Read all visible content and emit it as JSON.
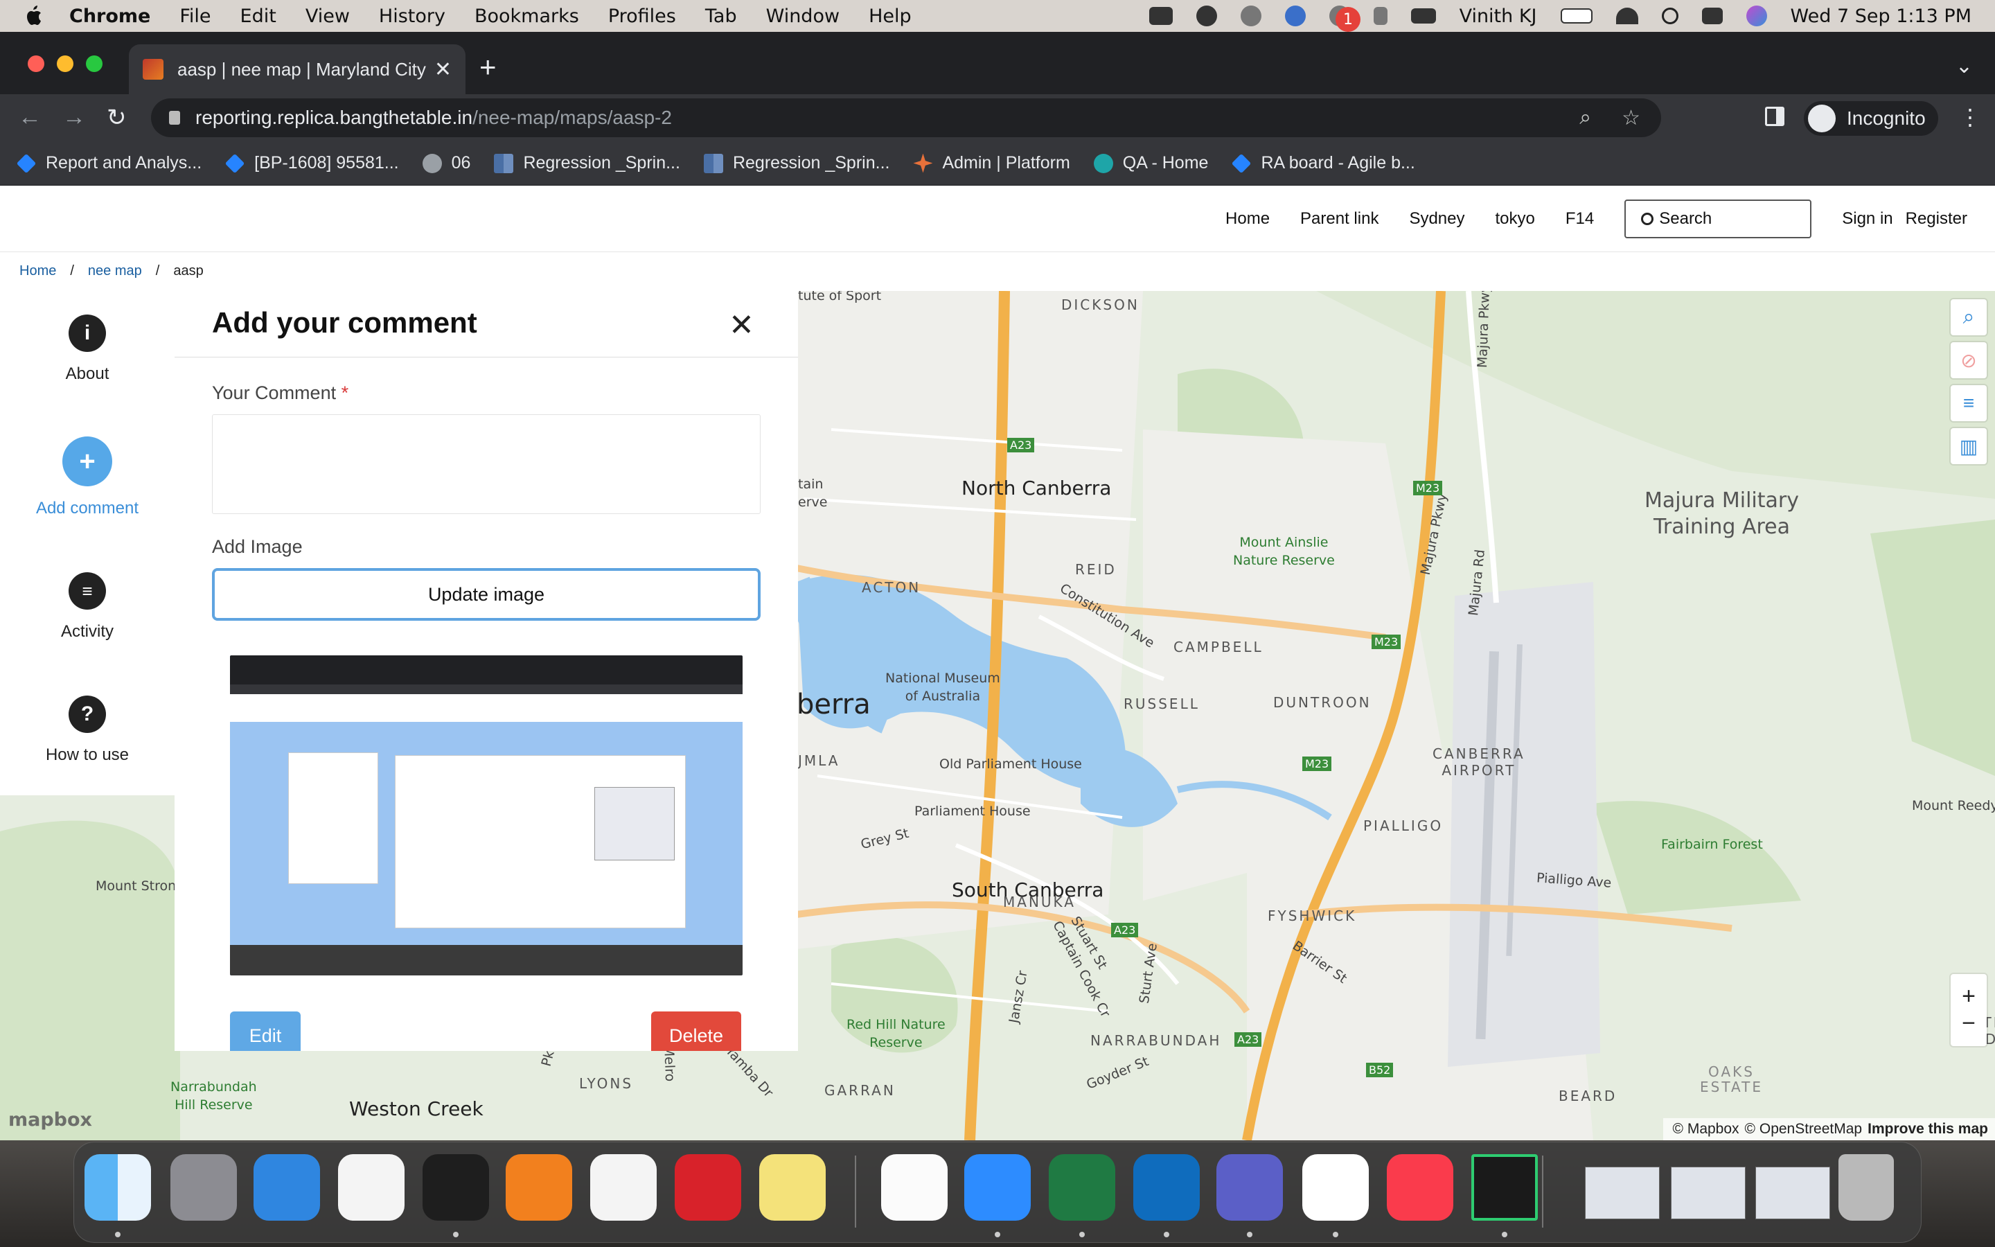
{
  "menubar": {
    "app": "Chrome",
    "items": [
      "File",
      "Edit",
      "View",
      "History",
      "Bookmarks",
      "Profiles",
      "Tab",
      "Window",
      "Help"
    ],
    "user": "Vinith KJ",
    "datetime": "Wed 7 Sep  1:13 PM"
  },
  "browser": {
    "tab_title": "aasp | nee map | Maryland City",
    "url_host": "reporting.replica.bangthetable.in",
    "url_path": "/nee-map/maps/aasp-2",
    "profile": "Incognito",
    "bookmarks": [
      {
        "label": "Report and Analys...",
        "icon": "jira-icon"
      },
      {
        "label": "[BP-1608] 95581...",
        "icon": "jira-icon"
      },
      {
        "label": "06",
        "icon": "globe-icon"
      },
      {
        "label": "Regression _Sprin...",
        "icon": "grid-icon"
      },
      {
        "label": "Regression _Sprin...",
        "icon": "grid-icon"
      },
      {
        "label": "Admin | Platform",
        "icon": "admin-icon"
      },
      {
        "label": "QA - Home",
        "icon": "qa-icon"
      },
      {
        "label": "RA board - Agile b...",
        "icon": "jira-icon"
      }
    ]
  },
  "site": {
    "nav": [
      "Home",
      "Parent link",
      "Sydney",
      "tokyo",
      "F14"
    ],
    "search_placeholder": "Search",
    "sign_in": "Sign in",
    "register": "Register"
  },
  "breadcrumb": {
    "items": [
      "Home",
      "nee map",
      "aasp"
    ],
    "sep": "/"
  },
  "rail": {
    "about": "About",
    "add_comment": "Add comment",
    "activity": "Activity",
    "how_to_use": "How to use"
  },
  "panel": {
    "title": "Add your comment",
    "comment_label": "Your Comment",
    "required_mark": "*",
    "image_label": "Add Image",
    "update_image": "Update image",
    "edit": "Edit",
    "delete": "Delete"
  },
  "map": {
    "labels": {
      "north_canberra": "North Canberra",
      "south_canberra": "South Canberra",
      "majura": "Majura Military\nTraining Area",
      "dickson": "DICKSON",
      "reid": "REID",
      "acton": "ACTON",
      "campbell": "CAMPBELL",
      "russell": "RUSSELL",
      "duntroon": "DUNTROON",
      "airport": "CANBERRA\nAIRPORT",
      "pialligo": "PIALLIGO",
      "fyshwick": "FYSHWICK",
      "manuka": "MANUKA",
      "narrabundah": "NARRABUNDAH",
      "garran": "GARRAN",
      "lyons": "LYONS",
      "beard": "BEARD",
      "museum": "National Museum\nof Australia",
      "old_parliament": "Old Parliament House",
      "parliament": "Parliament House",
      "ainslie": "Mount Ainslie\nNature Reserve",
      "fairbairn": "Fairbairn Forest",
      "red_hill": "Red Hill Nature\nReserve",
      "narrabundah_hill": "Narrabundah\nHill Reserve",
      "mount_stron": "Mount Stron",
      "mount_reedy": "Mount Reedy",
      "weston_creek": "Weston Creek",
      "sport": "tute of Sport",
      "berra": "berra",
      "tain": "tain\nerve",
      "umla": "JMLA",
      "th_ridge": "TH\nRIDGE",
      "oaks": "OAKS\nESTATE",
      "constitution": "Constitution Ave",
      "pialligo_ave": "Pialligo Ave",
      "barrier": "Barrier St",
      "grey": "Grey St",
      "stuart": "Stuart St",
      "captain_cook": "Captain Cook Cr",
      "jansz": "Jansz Cr",
      "sturt": "Sturt Ave",
      "goyder": "Goyder St",
      "yamba": "Yamba Dr",
      "majura_pkwy": "Majura Pkwy",
      "majura_rd": "Majura Rd",
      "a23": "A23",
      "m23": "M23",
      "b52": "B52",
      "pkwy": "Pkwy",
      "melrose": "Melro"
    },
    "attribution_mapbox": "© Mapbox",
    "attribution_osm": "© OpenStreetMap",
    "attribution_improve": "Improve this map",
    "logo": "mapbox",
    "zoom_in": "+",
    "zoom_out": "−"
  },
  "dock": {
    "slack_badge": "1",
    "apps": [
      "finder-icon",
      "launchpad-icon",
      "safari-icon",
      "brave-icon",
      "terminal-icon",
      "firefox-icon",
      "chrome-icon",
      "opera-icon",
      "stickies-icon",
      "notes-icon",
      "zoom-icon",
      "excel-icon",
      "outlook-icon",
      "teams-icon",
      "slack-icon",
      "music-icon",
      "pycharm-icon",
      "trash-icon"
    ]
  }
}
